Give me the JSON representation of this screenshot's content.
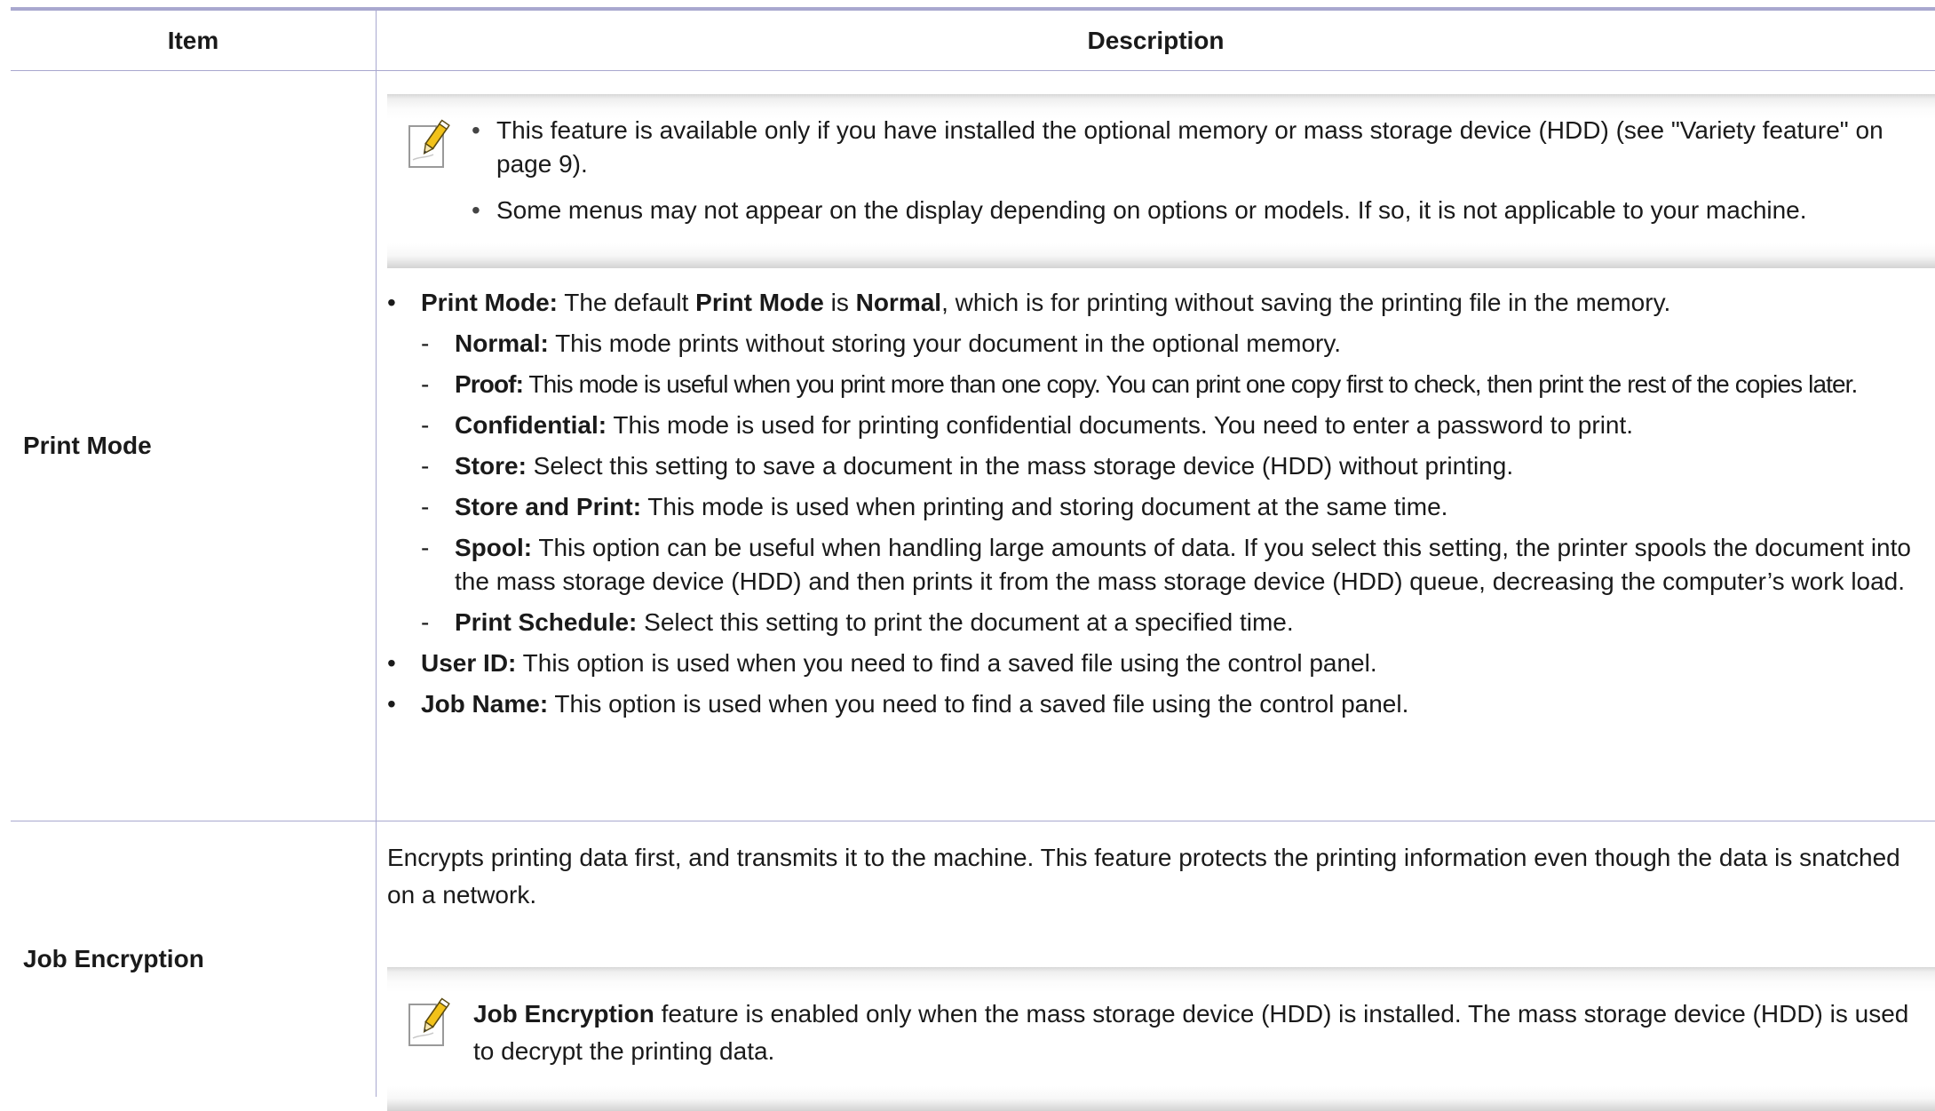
{
  "header": {
    "item": "Item",
    "description": "Description"
  },
  "print_mode": {
    "label": "Print Mode",
    "note": {
      "icon": "note-pencil-icon",
      "bullets": [
        "This feature is available only if you have installed the optional memory or mass storage device (HDD) (see \"Variety feature\" on page 9).",
        "Some menus may not appear on the display depending on options or models. If so, it is not applicable to your machine."
      ]
    },
    "intro": {
      "term": "Print Mode:",
      "t1": " The default ",
      "b1": "Print Mode",
      "t2": " is ",
      "b2": "Normal",
      "t3": ", which is for printing without saving the printing file in the memory."
    },
    "modes": [
      {
        "term": "Normal:",
        "text": " This mode prints without storing your document in the optional memory."
      },
      {
        "term": "Proof:",
        "text": " This mode is useful when you print more than one copy. You can print one copy first to check, then print the rest of the copies later."
      },
      {
        "term": "Confidential:",
        "text": " This mode is used for printing confidential documents. You need to enter a password to print."
      },
      {
        "term": "Store:",
        "text": " Select this setting to save a document in the mass storage device (HDD) without printing."
      },
      {
        "term": "Store and Print:",
        "text": " This mode is used when printing and storing document at the same time."
      },
      {
        "term": "Spool:",
        "text": " This option can be useful when handling large amounts of data. If you select this setting, the printer spools the document into the mass storage device (HDD) and then prints it from the mass storage device (HDD) queue, decreasing the computer’s work load."
      },
      {
        "term": "Print Schedule:",
        "text": " Select this setting to print the document at a specified time."
      }
    ],
    "extra": [
      {
        "term": "User ID:",
        "text": " This option is used when you need to find a saved file using the control panel."
      },
      {
        "term": "Job Name:",
        "text": " This option is used when you need to find a saved file using the control panel."
      }
    ]
  },
  "job_encryption": {
    "label": "Job Encryption",
    "text": "Encrypts printing data first, and transmits it to the machine. This feature protects the printing information even though the data is snatched on a network.",
    "note": {
      "icon": "note-pencil-icon",
      "term": "Job Encryption",
      "text": " feature is enabled only when the mass storage device (HDD) is installed. The mass storage device (HDD) is used to decrypt the printing data."
    }
  },
  "markers": {
    "bullet": "•",
    "dash": "-"
  },
  "colors": {
    "rule": "#a9a8cf",
    "pencil": "#f2c21a"
  }
}
